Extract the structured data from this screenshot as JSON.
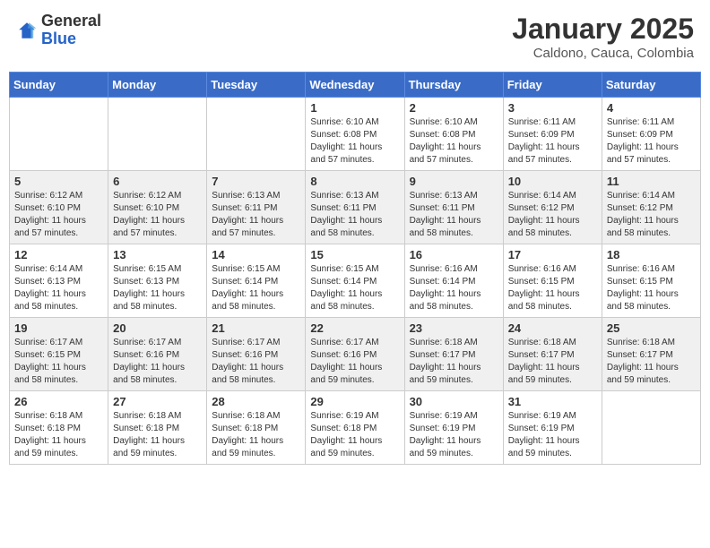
{
  "header": {
    "logo_general": "General",
    "logo_blue": "Blue",
    "month_title": "January 2025",
    "subtitle": "Caldono, Cauca, Colombia"
  },
  "weekdays": [
    "Sunday",
    "Monday",
    "Tuesday",
    "Wednesday",
    "Thursday",
    "Friday",
    "Saturday"
  ],
  "weeks": [
    [
      {
        "day": "",
        "info": ""
      },
      {
        "day": "",
        "info": ""
      },
      {
        "day": "",
        "info": ""
      },
      {
        "day": "1",
        "info": "Sunrise: 6:10 AM\nSunset: 6:08 PM\nDaylight: 11 hours and 57 minutes."
      },
      {
        "day": "2",
        "info": "Sunrise: 6:10 AM\nSunset: 6:08 PM\nDaylight: 11 hours and 57 minutes."
      },
      {
        "day": "3",
        "info": "Sunrise: 6:11 AM\nSunset: 6:09 PM\nDaylight: 11 hours and 57 minutes."
      },
      {
        "day": "4",
        "info": "Sunrise: 6:11 AM\nSunset: 6:09 PM\nDaylight: 11 hours and 57 minutes."
      }
    ],
    [
      {
        "day": "5",
        "info": "Sunrise: 6:12 AM\nSunset: 6:10 PM\nDaylight: 11 hours and 57 minutes."
      },
      {
        "day": "6",
        "info": "Sunrise: 6:12 AM\nSunset: 6:10 PM\nDaylight: 11 hours and 57 minutes."
      },
      {
        "day": "7",
        "info": "Sunrise: 6:13 AM\nSunset: 6:11 PM\nDaylight: 11 hours and 57 minutes."
      },
      {
        "day": "8",
        "info": "Sunrise: 6:13 AM\nSunset: 6:11 PM\nDaylight: 11 hours and 58 minutes."
      },
      {
        "day": "9",
        "info": "Sunrise: 6:13 AM\nSunset: 6:11 PM\nDaylight: 11 hours and 58 minutes."
      },
      {
        "day": "10",
        "info": "Sunrise: 6:14 AM\nSunset: 6:12 PM\nDaylight: 11 hours and 58 minutes."
      },
      {
        "day": "11",
        "info": "Sunrise: 6:14 AM\nSunset: 6:12 PM\nDaylight: 11 hours and 58 minutes."
      }
    ],
    [
      {
        "day": "12",
        "info": "Sunrise: 6:14 AM\nSunset: 6:13 PM\nDaylight: 11 hours and 58 minutes."
      },
      {
        "day": "13",
        "info": "Sunrise: 6:15 AM\nSunset: 6:13 PM\nDaylight: 11 hours and 58 minutes."
      },
      {
        "day": "14",
        "info": "Sunrise: 6:15 AM\nSunset: 6:14 PM\nDaylight: 11 hours and 58 minutes."
      },
      {
        "day": "15",
        "info": "Sunrise: 6:15 AM\nSunset: 6:14 PM\nDaylight: 11 hours and 58 minutes."
      },
      {
        "day": "16",
        "info": "Sunrise: 6:16 AM\nSunset: 6:14 PM\nDaylight: 11 hours and 58 minutes."
      },
      {
        "day": "17",
        "info": "Sunrise: 6:16 AM\nSunset: 6:15 PM\nDaylight: 11 hours and 58 minutes."
      },
      {
        "day": "18",
        "info": "Sunrise: 6:16 AM\nSunset: 6:15 PM\nDaylight: 11 hours and 58 minutes."
      }
    ],
    [
      {
        "day": "19",
        "info": "Sunrise: 6:17 AM\nSunset: 6:15 PM\nDaylight: 11 hours and 58 minutes."
      },
      {
        "day": "20",
        "info": "Sunrise: 6:17 AM\nSunset: 6:16 PM\nDaylight: 11 hours and 58 minutes."
      },
      {
        "day": "21",
        "info": "Sunrise: 6:17 AM\nSunset: 6:16 PM\nDaylight: 11 hours and 58 minutes."
      },
      {
        "day": "22",
        "info": "Sunrise: 6:17 AM\nSunset: 6:16 PM\nDaylight: 11 hours and 59 minutes."
      },
      {
        "day": "23",
        "info": "Sunrise: 6:18 AM\nSunset: 6:17 PM\nDaylight: 11 hours and 59 minutes."
      },
      {
        "day": "24",
        "info": "Sunrise: 6:18 AM\nSunset: 6:17 PM\nDaylight: 11 hours and 59 minutes."
      },
      {
        "day": "25",
        "info": "Sunrise: 6:18 AM\nSunset: 6:17 PM\nDaylight: 11 hours and 59 minutes."
      }
    ],
    [
      {
        "day": "26",
        "info": "Sunrise: 6:18 AM\nSunset: 6:18 PM\nDaylight: 11 hours and 59 minutes."
      },
      {
        "day": "27",
        "info": "Sunrise: 6:18 AM\nSunset: 6:18 PM\nDaylight: 11 hours and 59 minutes."
      },
      {
        "day": "28",
        "info": "Sunrise: 6:18 AM\nSunset: 6:18 PM\nDaylight: 11 hours and 59 minutes."
      },
      {
        "day": "29",
        "info": "Sunrise: 6:19 AM\nSunset: 6:18 PM\nDaylight: 11 hours and 59 minutes."
      },
      {
        "day": "30",
        "info": "Sunrise: 6:19 AM\nSunset: 6:19 PM\nDaylight: 11 hours and 59 minutes."
      },
      {
        "day": "31",
        "info": "Sunrise: 6:19 AM\nSunset: 6:19 PM\nDaylight: 11 hours and 59 minutes."
      },
      {
        "day": "",
        "info": ""
      }
    ]
  ]
}
